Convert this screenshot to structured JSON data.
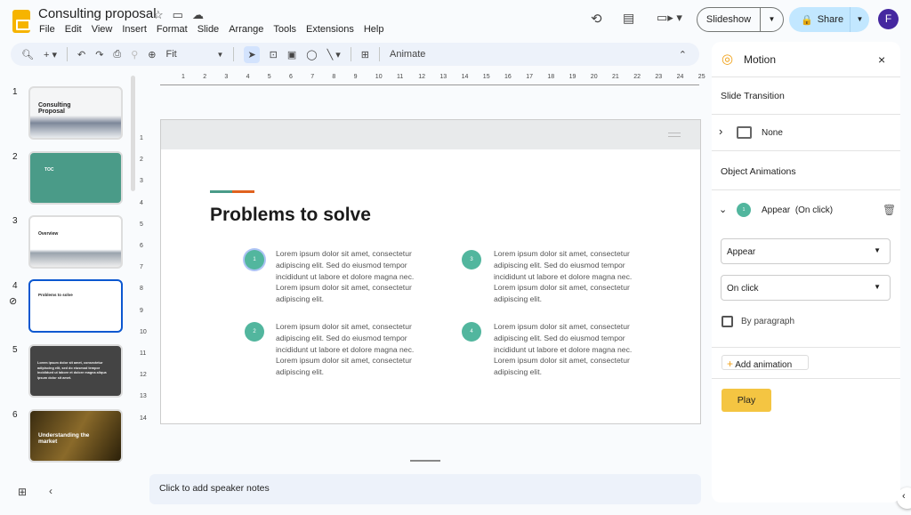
{
  "app": {
    "title": "Consulting proposal",
    "menu": [
      "File",
      "Edit",
      "View",
      "Insert",
      "Format",
      "Slide",
      "Arrange",
      "Tools",
      "Extensions",
      "Help"
    ],
    "slideshow_label": "Slideshow",
    "share_label": "Share",
    "avatar_letter": "F"
  },
  "toolbar": {
    "zoom_value": "Fit",
    "animate_label": "Animate"
  },
  "ruler": {
    "h": [
      "1",
      "2",
      "3",
      "4",
      "5",
      "6",
      "7",
      "8",
      "9",
      "10",
      "11",
      "12",
      "13",
      "14",
      "15",
      "16",
      "17",
      "18",
      "19",
      "20",
      "21",
      "22",
      "23",
      "24",
      "25"
    ],
    "v": [
      "1",
      "2",
      "3",
      "4",
      "5",
      "6",
      "7",
      "8",
      "9",
      "10",
      "11",
      "12",
      "13",
      "14"
    ]
  },
  "filmstrip": [
    {
      "num": "1",
      "title": "Consulting Proposal"
    },
    {
      "num": "2",
      "title": "TOC"
    },
    {
      "num": "3",
      "title": "Overview"
    },
    {
      "num": "4",
      "title": "Problems to solve"
    },
    {
      "num": "5",
      "title": "Lorem ipsum dolor sit amet, consectetur adipiscing elit, sed do eiusmod tempor incididunt ut labore et dolore magna aliqua ipsum dolor sit amet."
    },
    {
      "num": "6",
      "title": "Understanding the market"
    }
  ],
  "slide": {
    "title": "Problems to solve",
    "colors": {
      "teal": "#52b69e",
      "orange": "#e0621f"
    },
    "bullets": [
      {
        "n": "1",
        "text": "Lorem ipsum dolor sit amet, consectetur adipiscing elit. Sed do eiusmod tempor incididunt ut labore et dolore magna nec. Lorem ipsum dolor sit amet, consectetur adipiscing elit."
      },
      {
        "n": "2",
        "text": "Lorem ipsum dolor sit amet, consectetur adipiscing elit. Sed do eiusmod tempor incididunt ut labore et dolore magna nec. Lorem ipsum dolor sit amet, consectetur adipiscing elit."
      },
      {
        "n": "3",
        "text": "Lorem ipsum dolor sit amet, consectetur adipiscing elit. Sed do eiusmod tempor incididunt ut labore et dolore magna nec. Lorem ipsum dolor sit amet, consectetur adipiscing elit."
      },
      {
        "n": "4",
        "text": "Lorem ipsum dolor sit amet, consectetur adipiscing elit. Sed do eiusmod tempor incididunt ut labore et dolore magna nec. Lorem ipsum dolor sit amet, consectetur adipiscing elit."
      }
    ]
  },
  "notes": {
    "placeholder": "Click to add speaker notes"
  },
  "motion": {
    "title": "Motion",
    "slide_transition": "Slide Transition",
    "transition_value": "None",
    "object_animations": "Object Animations",
    "anim_num": "1",
    "anim_name": "Appear",
    "anim_trigger": "(On click)",
    "effect": "Appear",
    "start": "On click",
    "by_paragraph": "By paragraph",
    "by_paragraph_checked": false,
    "add_animation": "Add animation",
    "play": "Play",
    "play_color": "#f4c542"
  }
}
